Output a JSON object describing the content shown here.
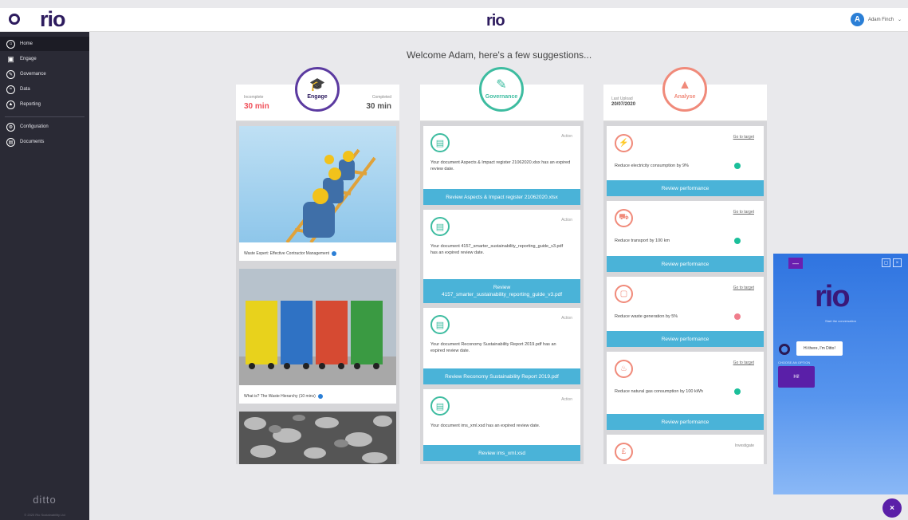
{
  "brand": {
    "logo_word": "rio",
    "center_logo": "rio"
  },
  "user": {
    "initial": "A",
    "name": "Adam Finch",
    "chevron": "chevron-down-icon"
  },
  "sidebar": {
    "items": [
      {
        "label": "Home",
        "icon": "home-icon"
      },
      {
        "label": "Engage",
        "icon": "graduation-cap-icon"
      },
      {
        "label": "Governance",
        "icon": "pencil-icon"
      },
      {
        "label": "Data",
        "icon": "data-icon"
      },
      {
        "label": "Reporting",
        "icon": "chart-icon"
      },
      {
        "label": "Configuration",
        "icon": "gear-icon"
      },
      {
        "label": "Documents",
        "icon": "document-icon"
      }
    ],
    "footer_logo": "ditto",
    "copyright": "© 2020 Rio Sustainability Ltd"
  },
  "welcome": "Welcome Adam, here's a few suggestions...",
  "engage": {
    "incomplete_label": "Incomplete",
    "incomplete_value": "30 min",
    "completed_label": "Completed",
    "completed_value": "30 min",
    "badge_label": "Engage",
    "cards": [
      {
        "caption": "Waste Expert: Effective Contractor Management"
      },
      {
        "caption": "What is? The Waste Hierarchy (10 mins)"
      }
    ]
  },
  "governance": {
    "badge_label": "Governance",
    "cards": [
      {
        "tag": "Action",
        "text": "Your document Aspects & Impact register 21062020.xlsx has an expired review date.",
        "button": "Review Aspects & Impact register 21062020.xlsx"
      },
      {
        "tag": "Action",
        "text": "Your document 4157_smarter_sustainability_reporting_guide_v3.pdf has an expired review date.",
        "button_line1": "Review",
        "button_line2": "4157_smarter_sustainability_reporting_guide_v3.pdf"
      },
      {
        "tag": "Action",
        "text": "Your document Reconomy Sustainability Report 2019.pdf has an expired review date.",
        "button": "Review Reconomy Sustainability Report 2019.pdf"
      },
      {
        "tag": "Action",
        "text": "Your document ims_xml.xsd has an expired review date.",
        "button": "Review ims_xml.xsd"
      }
    ]
  },
  "analyse": {
    "last_upload_label": "Last Upload",
    "last_upload_value": "20/07/2020",
    "badge_label": "Analyse",
    "cards": [
      {
        "link": "Go to target",
        "text": "Reduce electricity consumption by 9%",
        "status_color": "#1bbf9a",
        "button": "Review performance"
      },
      {
        "link": "Go to target",
        "text": "Reduce transport by 100 km",
        "status_color": "#1bbf9a",
        "button": "Review performance"
      },
      {
        "link": "Go to target",
        "text": "Reduce waste generation by 5%",
        "status_color": "#f07d8c",
        "button": "Review performance"
      },
      {
        "link": "Go to target",
        "text": "Reduce natural gas consumption by 100 kWh",
        "status_color": "#1bbf9a",
        "button": "Review performance"
      },
      {
        "tag": "Investigate"
      }
    ]
  },
  "chat": {
    "logo": "rio",
    "start_text": "Start the conversation",
    "greeting": "Hi there, I'm Ditto!",
    "choose_label": "CHOOSE AN OPTION",
    "option": "Hi!",
    "close": "×",
    "minimize": "—"
  },
  "colors": {
    "brand_purple": "#2d1b5e",
    "engage_accent": "#5b3aa0",
    "governance_accent": "#3dbca0",
    "analyse_accent": "#f08a7a",
    "button_blue": "#4ab3d8",
    "incomplete_red": "#f0505a"
  }
}
